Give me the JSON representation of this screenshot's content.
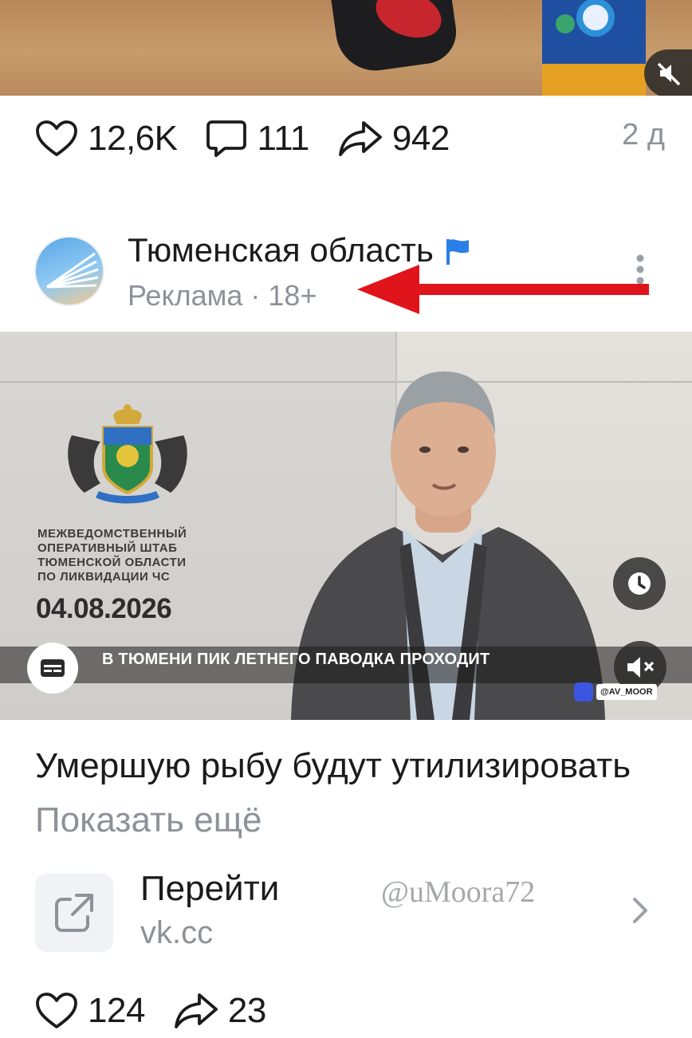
{
  "top_post": {
    "likes": "12,6K",
    "comments": "111",
    "shares": "942",
    "time": "2 д"
  },
  "ad_post": {
    "author": "Тюменская область",
    "meta": "Реклама · 18+",
    "video": {
      "hq_text": "МЕЖВЕДОМСТВЕННЫЙ\nОПЕРАТИВНЫЙ   ШТАБ\nТЮМЕНСКОЙ  ОБЛАСТИ\nПО   ЛИКВИДАЦИИ   ЧС",
      "date": "04.08.2026",
      "caption": "В ТЮМЕНИ ПИК ЛЕТНЕГО ПАВОДКА ПРОХОДИТ",
      "tag": "@AV_MOOR"
    },
    "text": "Умершую рыбу будут утилизировать",
    "show_more": "Показать ещё",
    "link": {
      "title": "Перейти",
      "domain": "vk.cc"
    },
    "likes": "124",
    "shares": "23"
  },
  "watermark": "@uMoora72",
  "colors": {
    "annotation_arrow": "#e0141b",
    "verified_flag": "#2a7ee8",
    "muted_text": "#8d9299"
  },
  "icons": [
    "heart-icon",
    "comment-icon",
    "share-icon",
    "flag-icon",
    "more-icon",
    "subtitles-icon",
    "clock-icon",
    "mute-icon",
    "external-link-icon",
    "chevron-right-icon"
  ]
}
